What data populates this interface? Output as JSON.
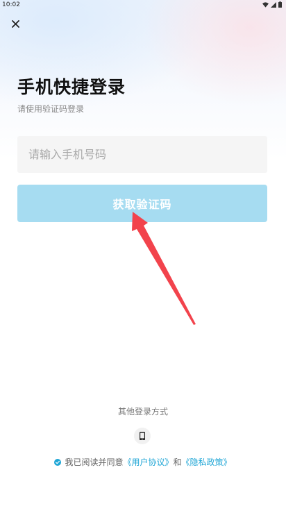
{
  "status_bar": {
    "time": "10:02",
    "icons": [
      "wifi-icon",
      "signal-icon",
      "battery-icon"
    ]
  },
  "header": {
    "close_icon": "close-icon"
  },
  "main": {
    "title": "手机快捷登录",
    "subtitle": "请使用验证码登录",
    "phone_input": {
      "placeholder": "请输入手机号码",
      "value": ""
    },
    "get_code_button": "获取验证码"
  },
  "other_login": {
    "label": "其他登录方式",
    "phone_icon": "phone-icon"
  },
  "agreement": {
    "prefix": "我已阅读并同意",
    "user_agreement": "《用户协议》",
    "and": "和",
    "privacy_policy": "《隐私政策》",
    "checked": true
  },
  "colors": {
    "button_bg": "#a6dcf1",
    "link": "#1fa6d6",
    "annotation_arrow": "#f2434c"
  }
}
